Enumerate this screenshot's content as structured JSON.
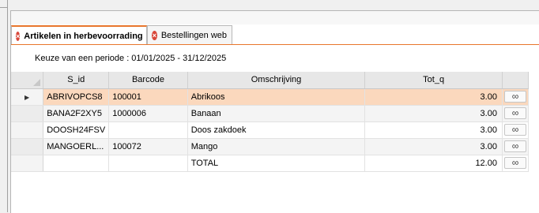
{
  "tabs": [
    {
      "label": "Artikelen in herbevoorrading",
      "active": true
    },
    {
      "label": "Bestellingen web",
      "active": false
    }
  ],
  "period_text": "Keuze van een periode : 01/01/2025 - 31/12/2025",
  "grid": {
    "columns": {
      "s_id": "S_id",
      "barcode": "Barcode",
      "omschrijving": "Omschrijving",
      "tot_q": "Tot_q"
    },
    "rows": [
      {
        "s_id": "ABRIVOPCS8",
        "barcode": "100001",
        "omschrijving": "Abrikoos",
        "tot_q": "3.00",
        "selected": true
      },
      {
        "s_id": "BANA2F2XY5",
        "barcode": "1000006",
        "omschrijving": "Banaan",
        "tot_q": "3.00"
      },
      {
        "s_id": "DOOSH24FSV",
        "barcode": "",
        "omschrijving": "Doos zakdoek",
        "tot_q": "3.00"
      },
      {
        "s_id": "MANGOERL...",
        "barcode": "100072",
        "omschrijving": "Mango",
        "tot_q": "3.00"
      },
      {
        "s_id": "",
        "barcode": "",
        "omschrijving": "TOTAL",
        "tot_q": "12.00"
      }
    ],
    "row_button_glyph": "∞",
    "current_row_glyph": "▶"
  },
  "icons": {
    "tab_close": "close-circle-icon",
    "row_button": "glasses-icon",
    "row_indicator": "current-row-arrow-icon"
  },
  "colors": {
    "accent": "#e8762c",
    "selected_row": "#fbd8bd",
    "close_icon": "#d9483b"
  }
}
